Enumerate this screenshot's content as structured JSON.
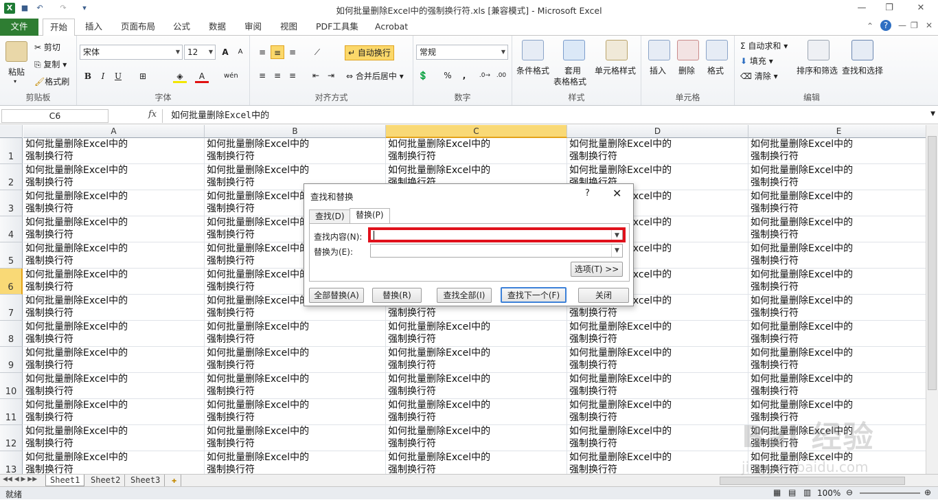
{
  "window": {
    "title": "如何批量删除Excel中的强制换行符.xls  [兼容模式] - Microsoft Excel"
  },
  "quick_access": [
    "save-icon",
    "undo-icon",
    "redo-icon",
    "customize-icon"
  ],
  "tabs": [
    "文件",
    "开始",
    "插入",
    "页面布局",
    "公式",
    "数据",
    "审阅",
    "视图",
    "PDF工具集",
    "Acrobat"
  ],
  "ribbon": {
    "clipboard": {
      "label": "剪贴板",
      "paste": "粘贴",
      "cut": "剪切",
      "copy": "复制",
      "format_painter": "格式刷"
    },
    "font": {
      "label": "字体",
      "name": "宋体",
      "size": "12",
      "bold": "B",
      "italic": "I",
      "underline": "U"
    },
    "alignment": {
      "label": "对齐方式",
      "wrap": "自动换行",
      "merge": "合并后居中"
    },
    "number": {
      "label": "数字",
      "format": "常规",
      "percent": "%",
      "comma": ","
    },
    "styles": {
      "label": "样式",
      "conditional": "条件格式",
      "table_line1": "套用",
      "table_line2": "表格格式",
      "cell_styles": "单元格样式"
    },
    "cells": {
      "label": "单元格",
      "insert": "插入",
      "delete": "删除",
      "format": "格式"
    },
    "editing": {
      "label": "编辑",
      "autosum": "自动求和",
      "fill": "填充",
      "clear": "清除",
      "sort": "排序和筛选",
      "find": "查找和选择"
    }
  },
  "formula_bar": {
    "name_box": "C6",
    "fx": "fx",
    "content": "如何批量删除Excel中的"
  },
  "grid": {
    "columns": [
      "A",
      "B",
      "C",
      "D",
      "E"
    ],
    "selected_column": "C",
    "rows": [
      "1",
      "2",
      "3",
      "4",
      "5",
      "6",
      "7",
      "8",
      "9",
      "10",
      "11",
      "12",
      "13"
    ],
    "selected_row": "6",
    "cell_line1": "如何批量删除Excel中的",
    "cell_line2": "强制换行符"
  },
  "sheets": [
    "Sheet1",
    "Sheet2",
    "Sheet3"
  ],
  "active_sheet": "Sheet1",
  "status": {
    "ready": "就绪",
    "zoom": "100%"
  },
  "dialog": {
    "title": "查找和替换",
    "help": "?",
    "close": "✕",
    "tab_find": "查找(D)",
    "tab_replace": "替换(P)",
    "find_label": "查找内容(N):",
    "find_value": "",
    "replace_label": "替换为(E):",
    "replace_value": "",
    "options": "选项(T) >>",
    "btn_replace_all": "全部替换(A)",
    "btn_replace": "替换(R)",
    "btn_find_all": "查找全部(I)",
    "btn_find_next": "查找下一个(F)",
    "btn_close": "关闭"
  },
  "watermark": {
    "line1": "Bai 经验",
    "line2": "jingyan.baidu.com"
  },
  "colors": {
    "file_tab": "#2e7d32",
    "selection": "#f9d976",
    "highlight": "#e0111b"
  }
}
